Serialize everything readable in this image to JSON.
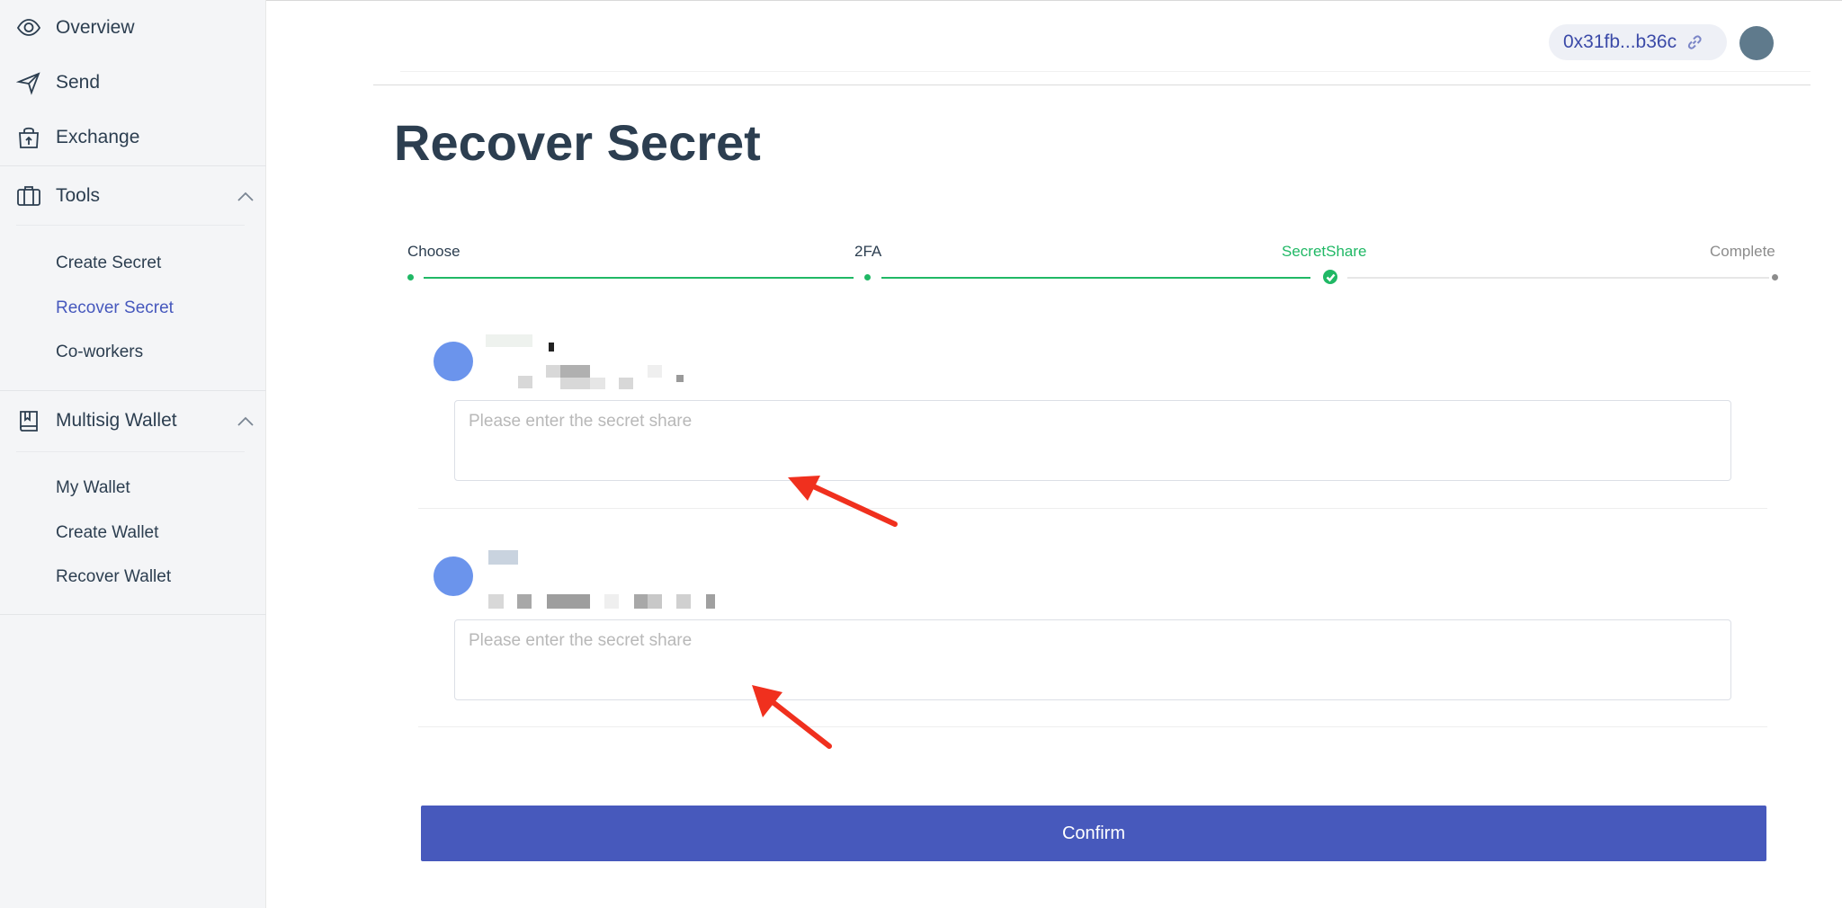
{
  "sidebar": {
    "items": [
      {
        "label": "Overview",
        "icon": "eye-icon"
      },
      {
        "label": "Send",
        "icon": "send-icon"
      },
      {
        "label": "Exchange",
        "icon": "bag-icon"
      }
    ],
    "tools": {
      "label": "Tools",
      "icon": "toolbox-icon",
      "expanded": true,
      "children": [
        "Create Secret",
        "Recover Secret",
        "Co-workers"
      ]
    },
    "multisig": {
      "label": "Multisig Wallet",
      "icon": "book-icon",
      "expanded": true,
      "children": [
        "My Wallet",
        "Create Wallet",
        "Recover Wallet"
      ]
    },
    "active_item": "Recover Secret",
    "active_color": "#4658bd"
  },
  "header": {
    "address": "0x31fb...b36c",
    "address_icon": "link-icon"
  },
  "page": {
    "title": "Recover Secret"
  },
  "steps": [
    {
      "label": "Choose",
      "status": "done"
    },
    {
      "label": "2FA",
      "status": "done"
    },
    {
      "label": "SecretShare",
      "status": "current"
    },
    {
      "label": "Complete",
      "status": "pending"
    }
  ],
  "shares": [
    {
      "placeholder": "Please enter the secret share",
      "value": ""
    },
    {
      "placeholder": "Please enter the secret share",
      "value": ""
    }
  ],
  "confirm_label": "Confirm",
  "colors": {
    "accent": "#4759bc",
    "success": "#20b865",
    "avatar": "#6b94ec",
    "annotation_arrow": "#f0301e"
  }
}
